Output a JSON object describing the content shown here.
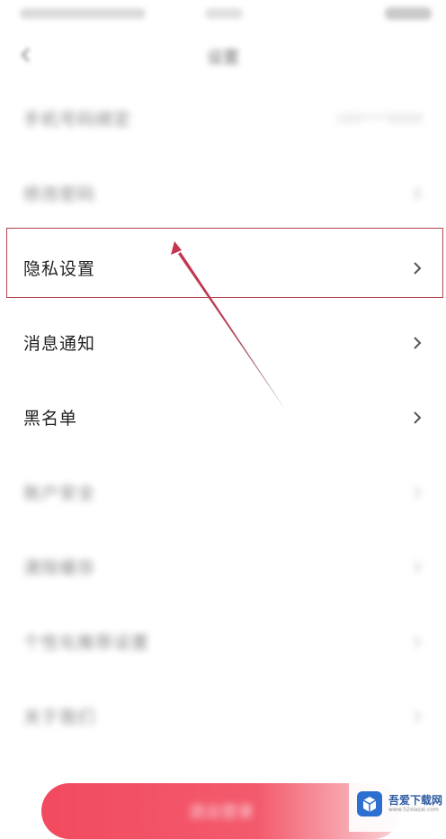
{
  "header": {
    "title": "设置"
  },
  "settings": {
    "items": [
      {
        "label": "手机号码绑定",
        "value": "189****8888",
        "blurred": true
      },
      {
        "label": "修改密码",
        "value": "",
        "blurred": true
      },
      {
        "label": "隐私设置",
        "value": "",
        "blurred": false,
        "highlighted": true
      },
      {
        "label": "消息通知",
        "value": "",
        "blurred": false
      },
      {
        "label": "黑名单",
        "value": "",
        "blurred": false
      },
      {
        "label": "账户安全",
        "value": "",
        "blurred": true
      },
      {
        "label": "清除缓存",
        "value": "",
        "blurred": true
      },
      {
        "label": "个性化推荐设置",
        "value": "",
        "blurred": true
      },
      {
        "label": "关于我们",
        "value": "",
        "blurred": true
      }
    ]
  },
  "bottom_button": {
    "label": "退出登录"
  },
  "watermark": {
    "title": "吾爱下载网",
    "subtitle": "www.52xiazai.com"
  },
  "colors": {
    "highlight": "#b4454e",
    "button": "#f24a5f",
    "chevron": "#555555",
    "watermark": "#2c5aa0"
  },
  "icons": {
    "back": "chevron-left-icon",
    "row_arrow": "chevron-right-icon",
    "annotation": "arrow-annotation-icon",
    "watermark_logo": "box-logo-icon"
  }
}
